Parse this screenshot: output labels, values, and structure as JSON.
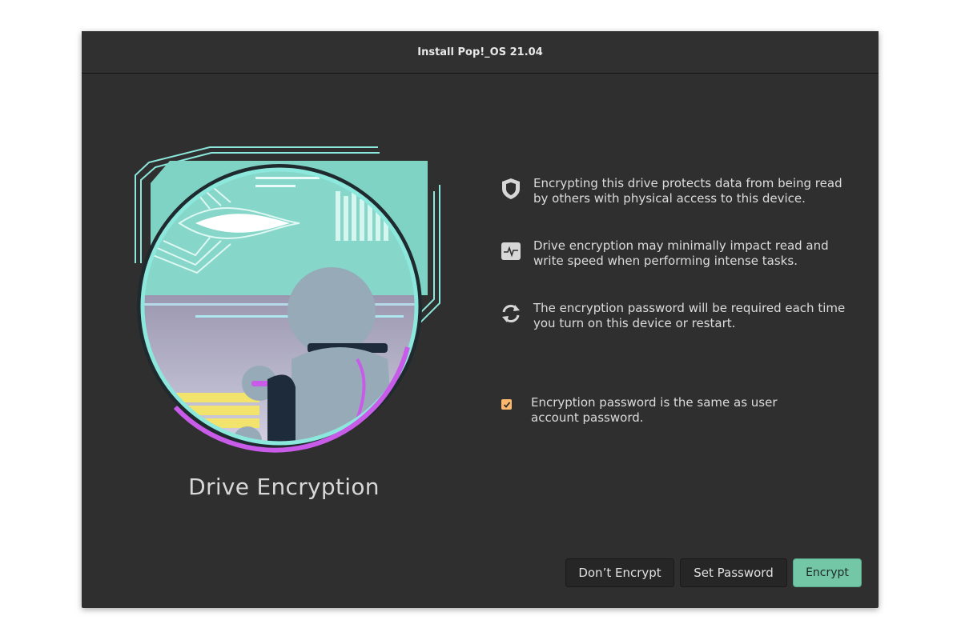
{
  "window": {
    "title": "Install Pop!_OS 21.04"
  },
  "main": {
    "page_title": "Drive Encryption",
    "illustration": "astronaut-spaceship-porthole",
    "info_items": [
      {
        "icon": "shield-icon",
        "text": "Encrypting this drive protects data from being read by others with physical access to this device."
      },
      {
        "icon": "activity-monitor-icon",
        "text": "Drive encryption may minimally impact read and write speed when performing intense tasks."
      },
      {
        "icon": "refresh-icon",
        "text": "The encryption password will be required each time you turn on this device or restart."
      }
    ],
    "same_password_checkbox": {
      "checked": true,
      "label": "Encryption password is the same as user account password."
    }
  },
  "actions": {
    "dont_encrypt_label": "Don’t Encrypt",
    "set_password_label": "Set Password",
    "encrypt_label": "Encrypt"
  },
  "colors": {
    "window_bg": "#2f2f2f",
    "accent_teal": "#73c6a6",
    "checkbox_orange": "#fbb86c",
    "illustration_cyan": "#8ce8dc",
    "illustration_magenta": "#c85ce8"
  }
}
